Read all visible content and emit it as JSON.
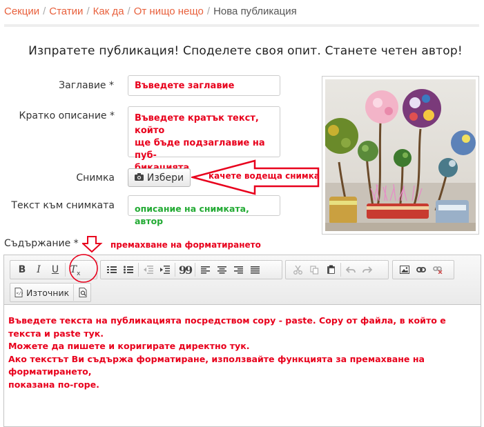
{
  "breadcrumb": {
    "items": [
      "Секции",
      "Статии",
      "Как да",
      "От нищо нещо"
    ],
    "current": "Нова публикация",
    "separator": "/"
  },
  "heading": "Изпратете публикация! Споделете своя опит. Станете четен автор!",
  "form": {
    "title_label": "Заглавие *",
    "title_value": "Въведете заглавие",
    "summary_label": "Кратко описание *",
    "summary_value": "Въведете кратък текст, който ще бъде подзаглавие на пуб-бикацията",
    "summary_lines": [
      "Въведете кратък текст, който",
      "ще бъде подзаглавие на пуб-",
      "бикацията"
    ],
    "photo_label": "Снимка",
    "photo_button": "Избери",
    "photo_text_label": "Текст към снимката",
    "photo_text_value": "описание на снимката, автор"
  },
  "annotations": {
    "photo_hint": "качете водеща снимка",
    "format_hint": "премахване на форматирането"
  },
  "content": {
    "label": "Съдържание *",
    "source_button": "Източник",
    "body_lines": [
      "Въведете текста на публикацията посредством copy - paste. Copy от файла, в който е текста и paste тук.",
      "Можете да пишете и коригирате директно тук.",
      "Ако текстът Ви съдържа форматиране, използвайте функцията за премахване на форматирането,",
      "показана по-горе."
    ]
  },
  "toolbar": {
    "bold": "B",
    "italic": "I",
    "underline": "U",
    "remove_format": "Tx",
    "blockquote": "99"
  },
  "colors": {
    "accent": "#e8603c",
    "annotation": "#e8001c",
    "green_text": "#22aa33"
  }
}
